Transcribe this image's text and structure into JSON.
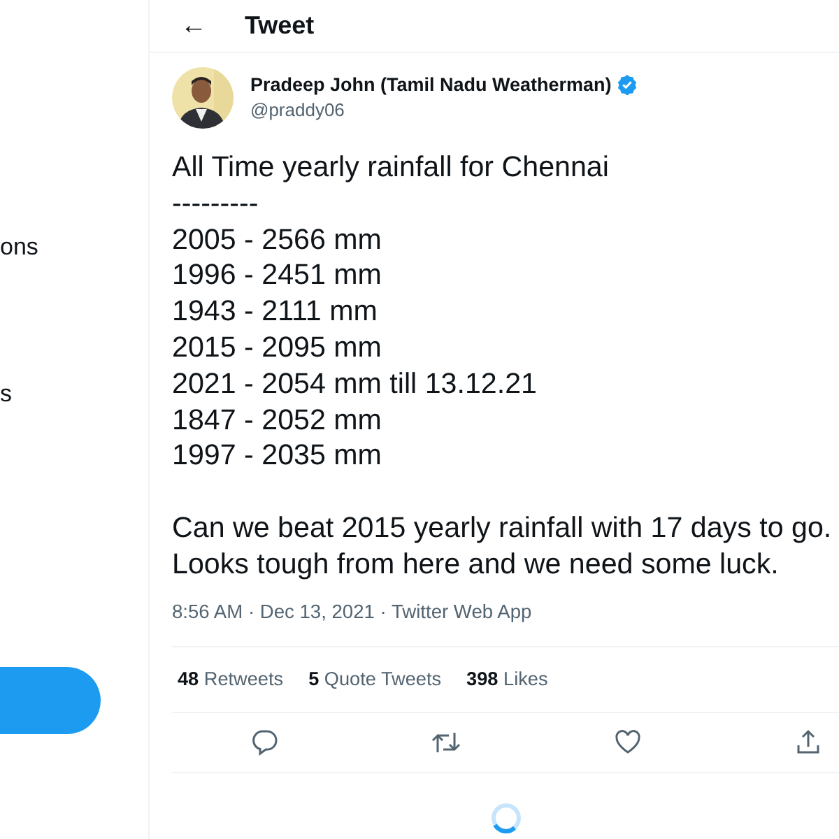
{
  "sidebar": {
    "items": [
      {
        "label": "ons"
      },
      {
        "label": "s"
      }
    ],
    "has_post_button": true
  },
  "header": {
    "back": "←",
    "title": "Tweet"
  },
  "tweet": {
    "author": {
      "name": "Pradeep John (Tamil Nadu Weatherman)",
      "handle": "@praddy06",
      "verified": true
    },
    "paragraphs": [
      [
        "All Time yearly rainfall for Chennai",
        "---------",
        "2005 - 2566 mm",
        "1996 - 2451 mm",
        "1943 - 2111 mm",
        "2015 - 2095 mm",
        "2021 - 2054 mm till 13.12.21",
        "1847 - 2052 mm",
        "1997 - 2035 mm"
      ],
      [
        "Can we beat 2015 yearly rainfall with 17 days to go.",
        "Looks tough from here and we need some luck."
      ]
    ],
    "meta": "8:56 AM · Dec 13, 2021 · Twitter Web App",
    "stats": [
      "**48** Retweets",
      "**5** Quote Tweets",
      "**398** Likes"
    ],
    "actions": [
      {
        "kind": "reply"
      },
      {
        "kind": "retweet"
      },
      {
        "kind": "like"
      },
      {
        "kind": "share"
      }
    ]
  },
  "loading": true
}
